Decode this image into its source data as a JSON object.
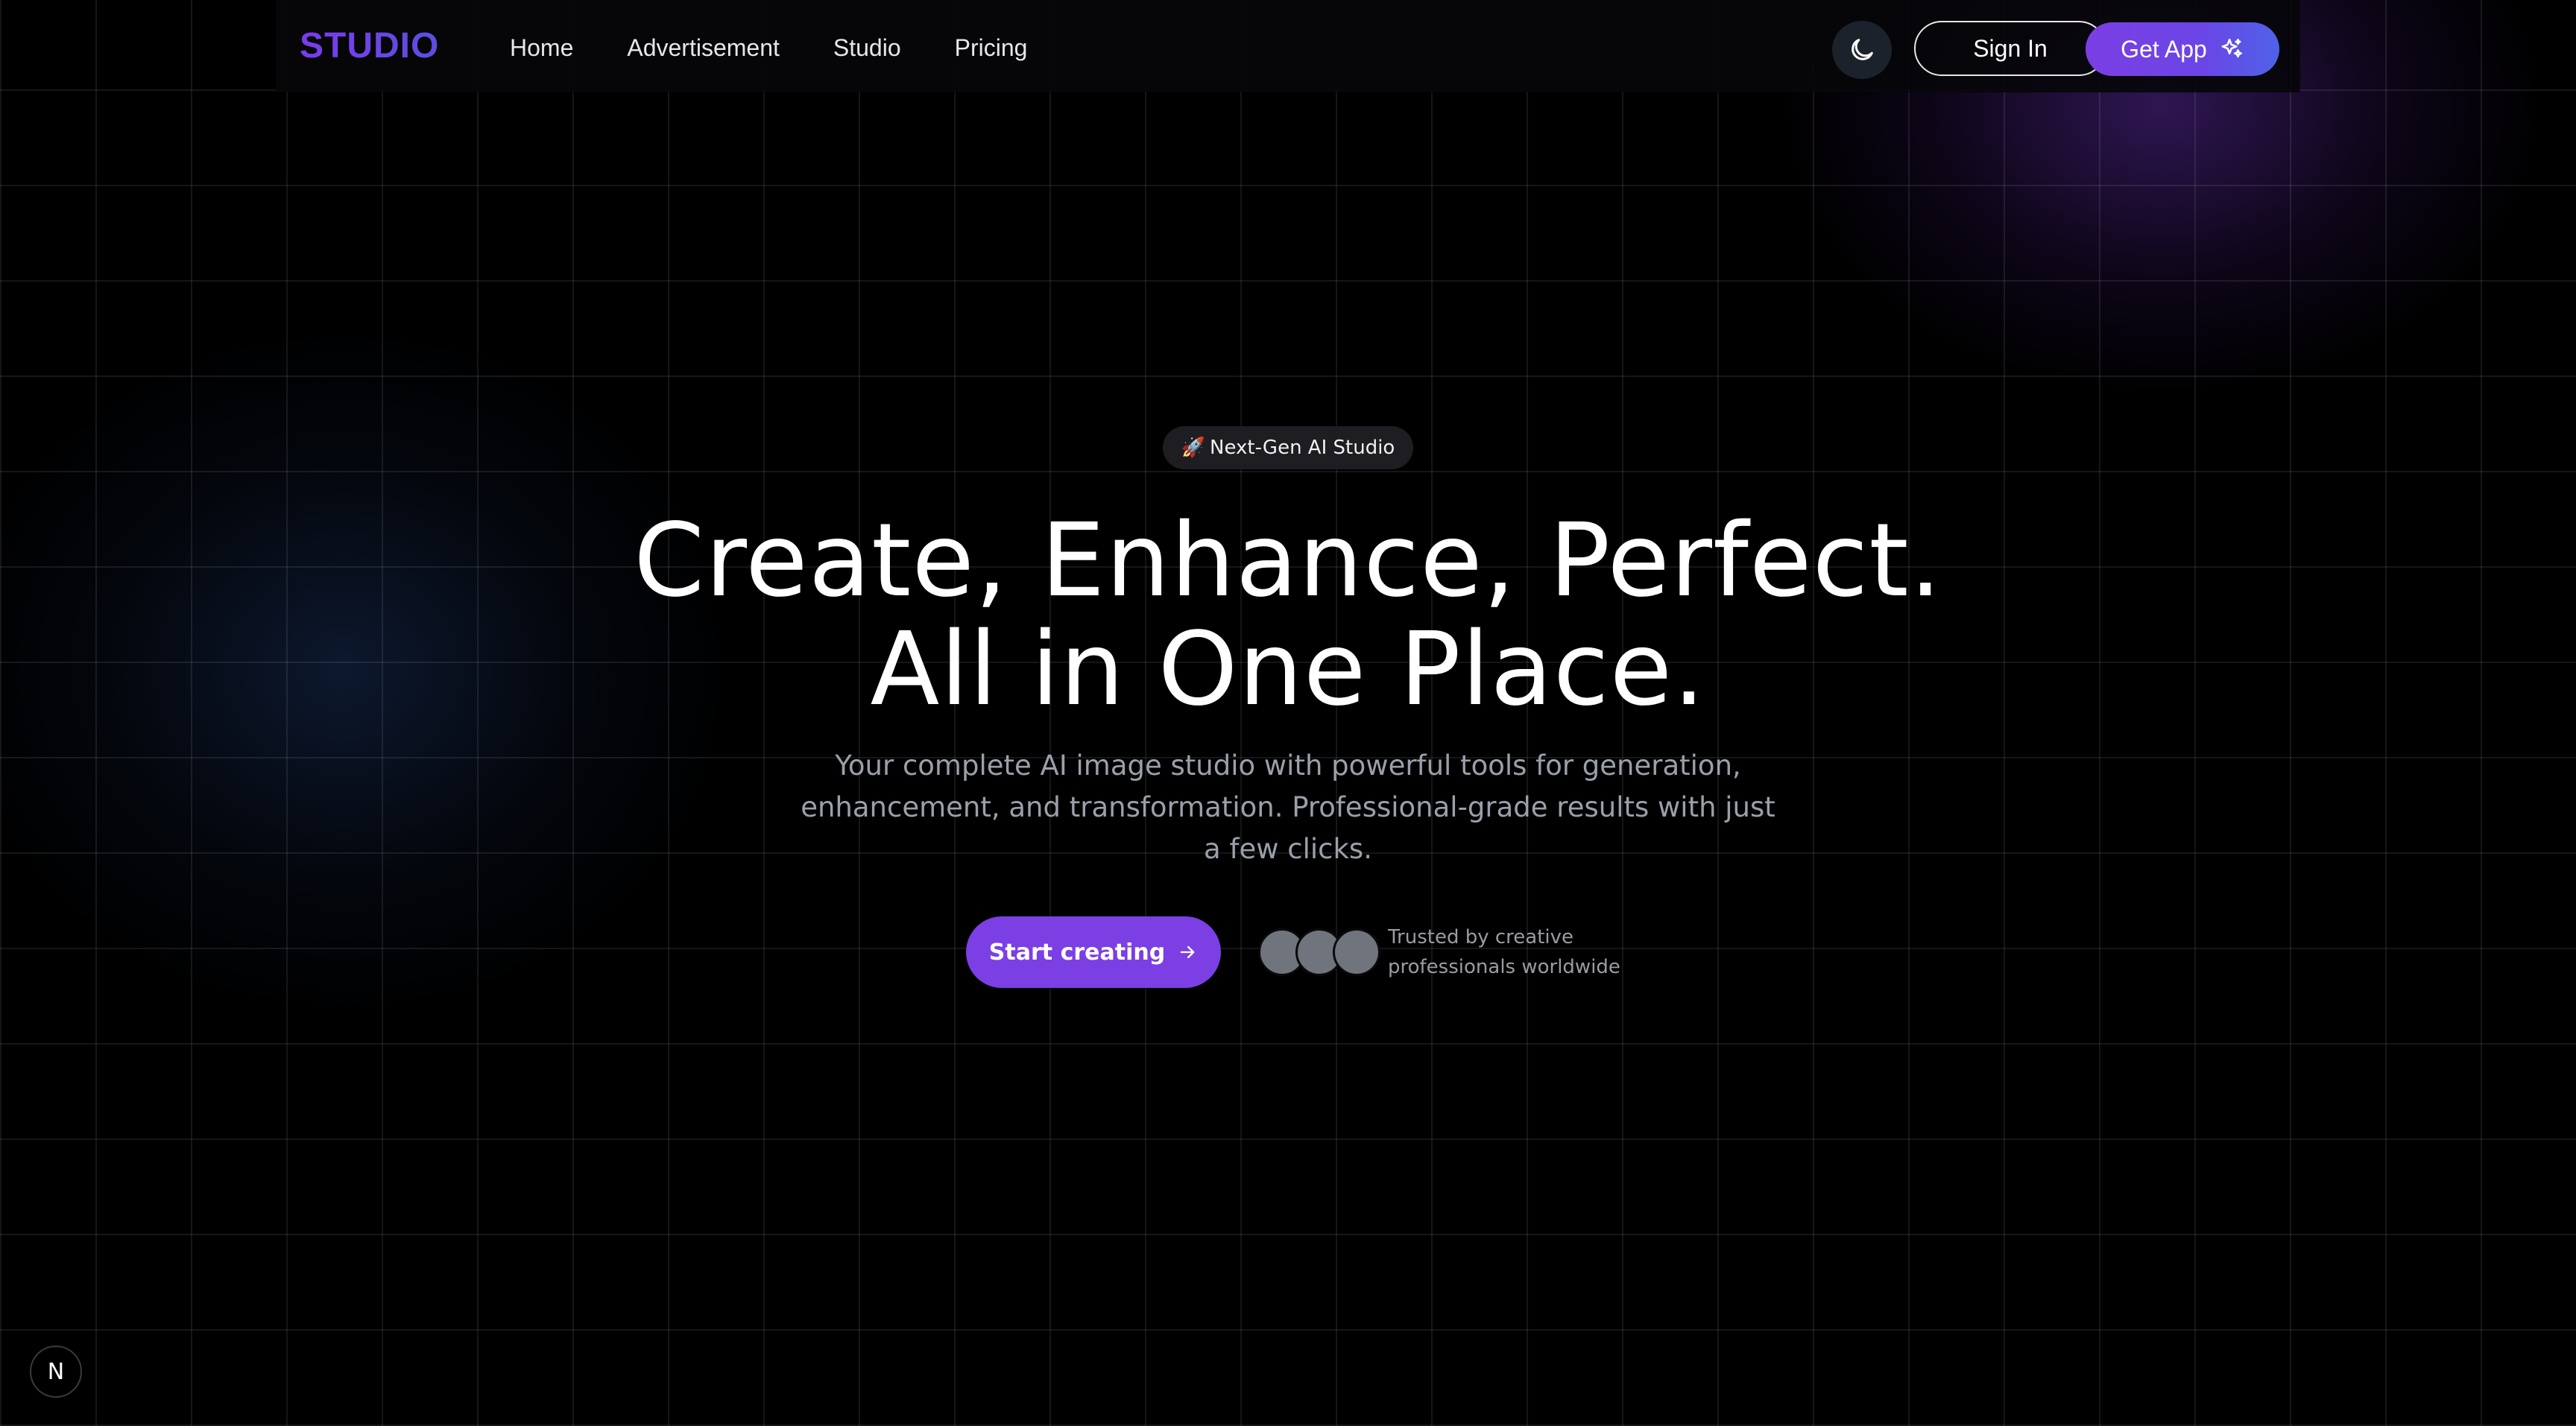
{
  "nav": {
    "logo": "STUDIO",
    "links": [
      "Home",
      "Advertisement",
      "Studio",
      "Pricing"
    ],
    "theme_toggle_icon": "moon-icon",
    "sign_in": "Sign In",
    "get_app": "Get App",
    "get_app_icon": "sparkles-icon"
  },
  "hero": {
    "badge_emoji": "🚀",
    "badge": "Next-Gen AI Studio",
    "headline_line1": "Create, Enhance, Perfect.",
    "headline_line2": "All in One Place.",
    "subtext": "Your complete AI image studio with powerful tools for generation, enhancement, and transformation. Professional-grade results with just a few clicks.",
    "cta": "Start creating",
    "cta_icon": "arrow-right-icon",
    "trust_text": "Trusted by creative professionals worldwide"
  },
  "dev_badge": "N",
  "colors": {
    "accent": "#7b3fe4",
    "accent_gradient_end": "#4f62e8",
    "background": "#000000",
    "muted_text": "#9aa0aa"
  }
}
